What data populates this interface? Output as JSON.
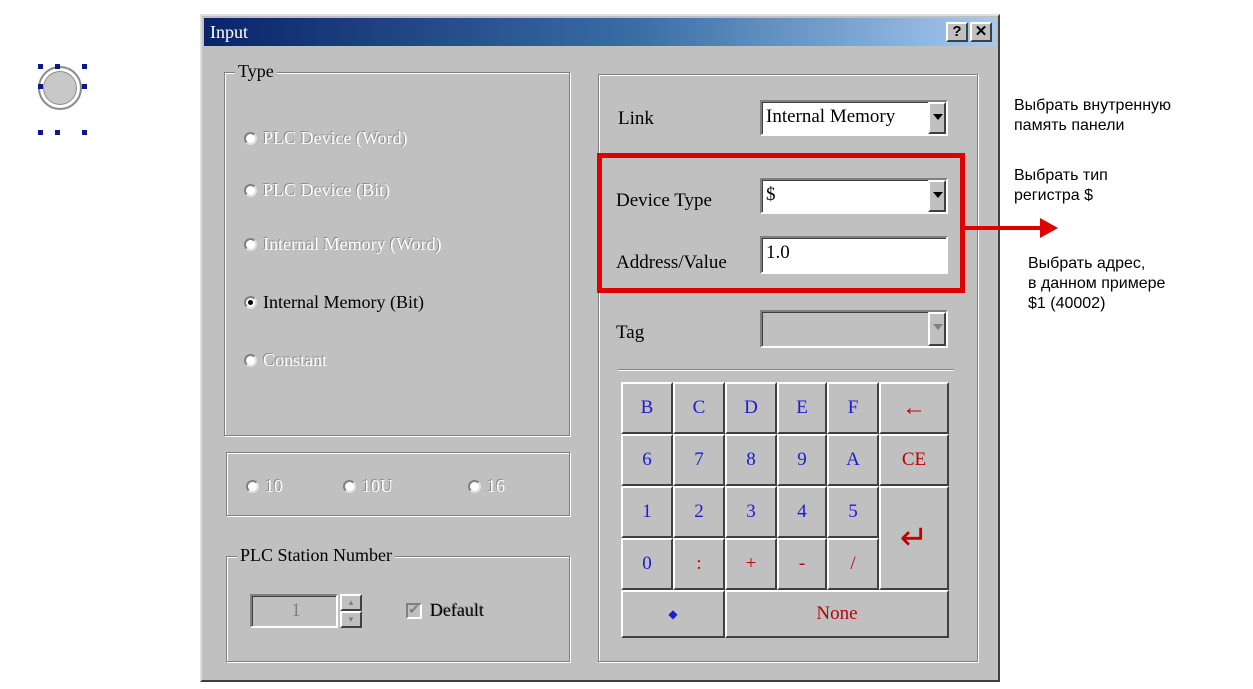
{
  "dialog": {
    "title": "Input",
    "help_label": "?",
    "close_label": "✕"
  },
  "type_group": {
    "legend": "Type",
    "options": [
      {
        "label": "PLC Device (Word)"
      },
      {
        "label": "PLC Device (Bit)"
      },
      {
        "label": "Internal Memory (Word)"
      },
      {
        "label": "Internal Memory (Bit)"
      },
      {
        "label": "Constant"
      }
    ]
  },
  "base_group": {
    "options": [
      "10",
      "10U",
      "16"
    ]
  },
  "station_group": {
    "legend": "PLC Station Number",
    "station_value": "1",
    "default_label": "Default"
  },
  "link": {
    "label": "Link",
    "value": "Internal Memory"
  },
  "device_type": {
    "label": "Device Type",
    "value": "$"
  },
  "address": {
    "label": "Address/Value",
    "value": "1.0"
  },
  "tag": {
    "label": "Tag",
    "value": ""
  },
  "keypad": {
    "row1": [
      "B",
      "C",
      "D",
      "E",
      "F",
      "←"
    ],
    "row2": [
      "6",
      "7",
      "8",
      "9",
      "A",
      "CE"
    ],
    "row3": [
      "1",
      "2",
      "3",
      "4",
      "5"
    ],
    "row4": [
      "0",
      ":",
      "+",
      "-",
      "/"
    ],
    "enter": "↵",
    "dot": "◆",
    "none": "None"
  },
  "annotations": {
    "link_note": [
      "Выбрать внутренную",
      "память панели"
    ],
    "type_note": [
      "Выбрать тип",
      "регистра $"
    ],
    "address_note": [
      "Выбрать адрес,",
      "в данном примере",
      "$1 (40002)"
    ]
  },
  "colors": {
    "highlight": "#e00000",
    "key_blue": "#1c1cd0",
    "key_red": "#c00000"
  }
}
